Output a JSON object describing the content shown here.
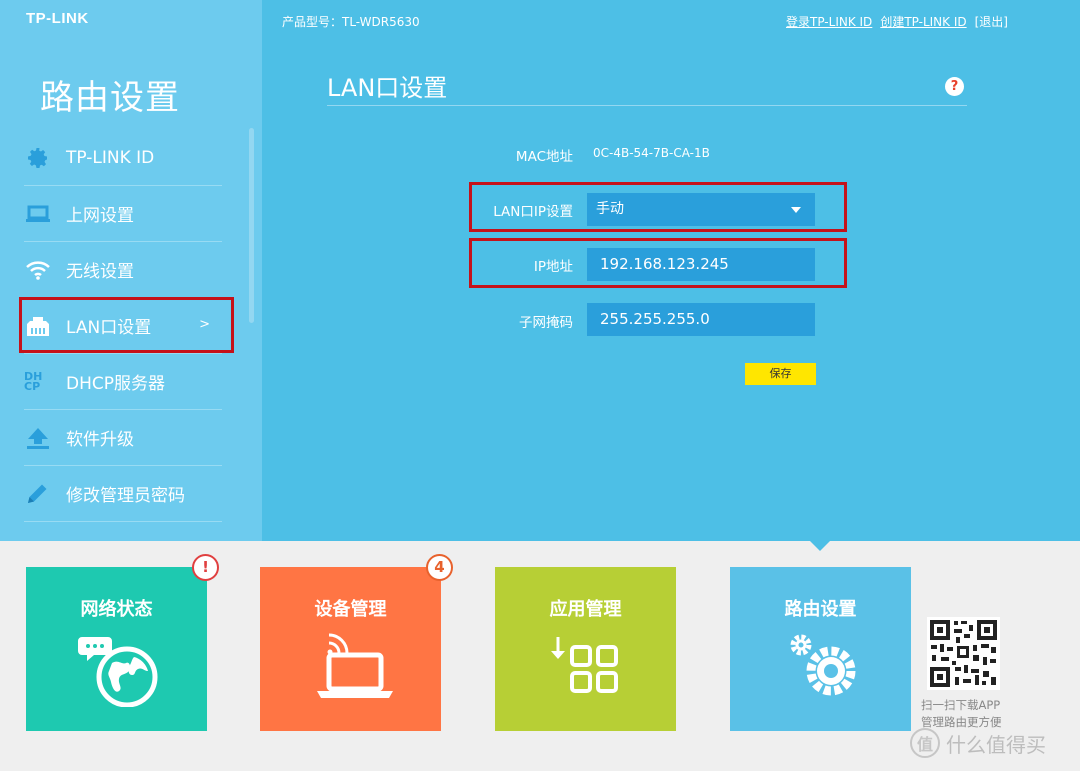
{
  "brand": {
    "logo": "TP-LINK"
  },
  "header": {
    "model_label": "产品型号：TL-WDR5630",
    "login_link": "登录TP-LINK ID",
    "create_link": "创建TP-LINK ID",
    "logout_link": "[退出]"
  },
  "sidebar": {
    "title": "路由设置",
    "items": [
      {
        "label": "TP-LINK ID",
        "icon": "gear-icon"
      },
      {
        "label": "上网设置",
        "icon": "laptop-icon"
      },
      {
        "label": "无线设置",
        "icon": "wifi-icon"
      },
      {
        "label": "LAN口设置",
        "icon": "ethernet-port-icon",
        "active": true,
        "arrow": ">"
      },
      {
        "label": "DHCP服务器",
        "icon": "dhcp-icon",
        "icon_text": "DH CP"
      },
      {
        "label": "软件升级",
        "icon": "upload-icon"
      },
      {
        "label": "修改管理员密码",
        "icon": "pencil-icon"
      }
    ]
  },
  "main": {
    "title": "LAN口设置",
    "help_icon": "?",
    "mac_label": "MAC地址",
    "mac_value": "0C-4B-54-7B-CA-1B",
    "lan_ip_mode_label": "LAN口IP设置",
    "lan_ip_mode_value": "手动",
    "ip_label": "IP地址",
    "ip_value": "192.168.123.245",
    "mask_label": "子网掩码",
    "mask_value": "255.255.255.0",
    "save_label": "保存"
  },
  "tiles": [
    {
      "label": "网络状态",
      "color": "#1ec9b0",
      "badge": "!"
    },
    {
      "label": "设备管理",
      "color": "#ff7544",
      "badge": "4"
    },
    {
      "label": "应用管理",
      "color": "#b7cf35"
    },
    {
      "label": "路由设置",
      "color": "#5ac1e7"
    }
  ],
  "qr": {
    "line1": "扫一扫下载APP",
    "line2": "管理路由更方便"
  },
  "watermark": {
    "icon_text": "值",
    "text": "什么值得买"
  },
  "colors": {
    "sidebar_bg": "#6dcbee",
    "main_bg": "#4dbfe6",
    "field_bg": "#2a9fdb",
    "save_button": "#ffe600",
    "highlight_box": "#c5121a"
  }
}
